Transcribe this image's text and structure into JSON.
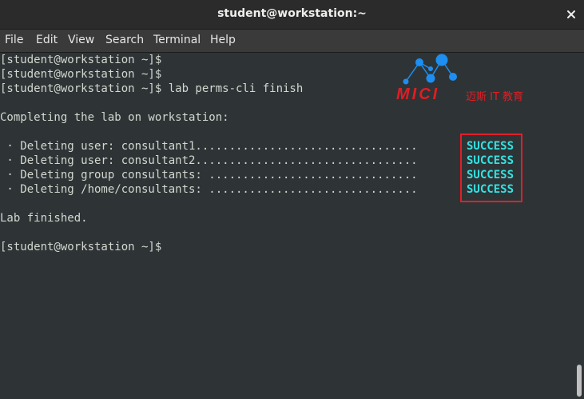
{
  "window": {
    "title": "student@workstation:~"
  },
  "menu": {
    "items": [
      "File",
      "Edit",
      "View",
      "Search",
      "Terminal",
      "Help"
    ]
  },
  "terminal": {
    "lines": [
      "[student@workstation ~]$",
      "[student@workstation ~]$",
      "[student@workstation ~]$ lab perms-cli finish",
      "",
      "Completing the lab on workstation:",
      "",
      " · Deleting user: consultant1.................................",
      " · Deleting user: consultant2.................................",
      " · Deleting group consultants: ...............................",
      " · Deleting /home/consultants: ...............................",
      "",
      "Lab finished.",
      "",
      "[student@workstation ~]$"
    ],
    "status": [
      "SUCCESS",
      "SUCCESS",
      "SUCCESS",
      "SUCCESS"
    ]
  },
  "watermark": {
    "wordmark": "MICI",
    "tagline": "迈斯 IT 教育",
    "color": "#e11d24",
    "node_color": "#1e8ef0"
  },
  "colors": {
    "background": "#2e3436",
    "text": "#d3d7cf",
    "success": "#34e2e2",
    "highlight": "#e0202a"
  }
}
